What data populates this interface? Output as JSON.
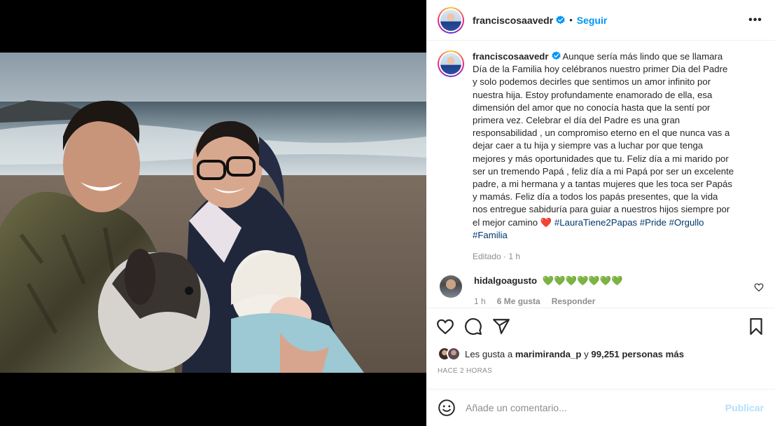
{
  "post": {
    "username": "franciscosaavedr",
    "follow_label": "Seguir",
    "more_label": "•••",
    "caption_username": "franciscosaavedr",
    "caption": "Aunque sería más lindo que se llamara Día de la Familia hoy celébranos nuestro primer Dia del Padre y solo podemos decirles que sentimos un amor infinito por nuestra hija. Estoy profundamente enamorado de ella, esa dimensión del amor que no conocía hasta que la sentí por primera vez. Celebrar el día del Padre es una gran responsabilidad , un compromiso eterno en el que nunca vas a dejar caer a tu hija y siempre vas a luchar por que tenga mejores y más oportunidades que tu. Feliz día a mi marido por ser un tremendo Papá , feliz día a mi Papá por ser un excelente padre, a mi hermana y a tantas mujeres que les toca ser Papás y mamás. Feliz día a todos los papás presentes, que la vida nos entregue sabiduría para guiar a nuestros hijos siempre por el mejor camino",
    "caption_emoji": "❤️",
    "hashtags": [
      "#LauraTiene2Papas",
      "#Pride",
      "#Orgullo",
      "#Familia"
    ],
    "edited_meta": "Editado · 1 h"
  },
  "comment": {
    "username": "hidalgoagusto",
    "text": "💚💚💚💚💚💚💚",
    "time": "1 h",
    "likes": "6 Me gusta",
    "reply_label": "Responder"
  },
  "likes": {
    "prefix": "Les gusta a",
    "first_user": "marimiranda_p",
    "connector": "y",
    "others": "99,251 personas más"
  },
  "time_ago": "HACE 2 HORAS",
  "add_comment": {
    "placeholder": "Añade un comentario...",
    "publish_label": "Publicar"
  },
  "colors": {
    "accent": "#0095f6",
    "hashtag": "#00376b",
    "publish_disabled": "#b2dffc",
    "muted": "#8e8e8e",
    "verified": "#0095f6"
  },
  "icons": [
    "heart-icon",
    "comment-icon",
    "share-icon",
    "bookmark-icon",
    "emoji-icon",
    "verified-icon",
    "more-icon"
  ]
}
